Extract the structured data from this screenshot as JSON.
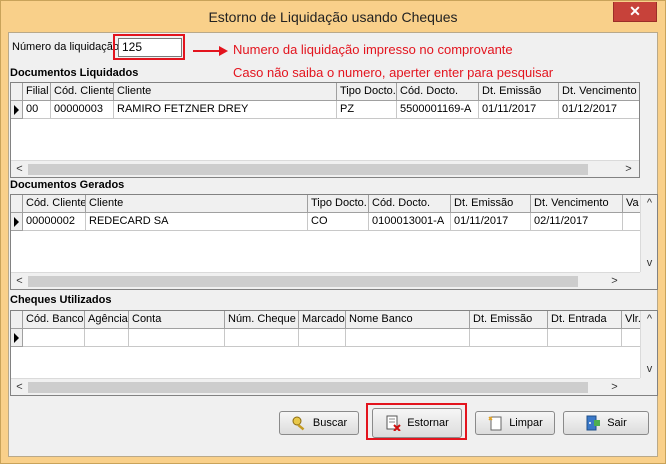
{
  "window": {
    "title": "Estorno de Liquidação usando Cheques",
    "close_glyph": "✕"
  },
  "liquidacao": {
    "label": "Número da liquidação",
    "value": "125"
  },
  "annotations": {
    "line1": "Numero da liquidação impresso no comprovante",
    "line2": "Caso não saiba o numero, aperter enter para pesquisar"
  },
  "documentos_liquidados": {
    "title": "Documentos Liquidados",
    "columns": [
      "Filial",
      "Cód. Cliente",
      "Cliente",
      "Tipo Docto.",
      "Cód. Docto.",
      "Dt. Emissão",
      "Dt. Vencimento"
    ],
    "rows": [
      [
        "00",
        "00000003",
        "RAMIRO FETZNER DREY",
        "PZ",
        "5500001169-A",
        "01/11/2017",
        "01/12/2017"
      ]
    ]
  },
  "documentos_gerados": {
    "title": "Documentos Gerados",
    "columns": [
      "Cód. Cliente",
      "Cliente",
      "Tipo Docto.",
      "Cód. Docto.",
      "Dt. Emissão",
      "Dt. Vencimento",
      "Va"
    ],
    "rows": [
      [
        "00000002",
        "REDECARD SA",
        "CO",
        "0100013001-A",
        "01/11/2017",
        "02/11/2017",
        ""
      ]
    ]
  },
  "cheques_utilizados": {
    "title": "Cheques Utilizados",
    "columns": [
      "Cód. Banco",
      "Agência",
      "Conta",
      "Núm. Cheque",
      "Marcado",
      "Nome Banco",
      "Dt. Emissão",
      "Dt. Entrada",
      "Vlr."
    ]
  },
  "buttons": {
    "buscar": "Buscar",
    "estornar": "Estornar",
    "limpar": "Limpar",
    "sair": "Sair"
  },
  "colors": {
    "title_bar": "#f9d08a",
    "annotation_red": "#e3141e",
    "close_red": "#c7423a"
  }
}
